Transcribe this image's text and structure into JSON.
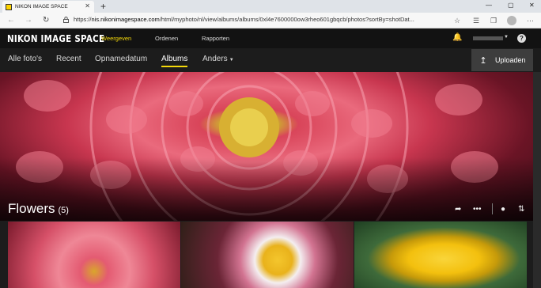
{
  "browser": {
    "tab_title": "NIKON IMAGE SPACE",
    "tab_close": "✕",
    "new_tab": "+",
    "window_controls": [
      "—",
      "▢",
      "✕"
    ],
    "url_scheme": "https://",
    "url_host": "nis.nikonimagespace.com",
    "url_rest": "/html/myphoto/nl/view/albums/albums/0xl4e7600000ow3rheo601gbqcb/photos?sortBy=shotDat...",
    "icons": [
      "back-icon",
      "forward-icon",
      "reload-icon",
      "lock-icon",
      "favorite-star-icon",
      "favorites-bar-icon",
      "collections-icon",
      "profile-icon",
      "more-icon"
    ]
  },
  "app": {
    "logo": "NIKON IMAGE SPACE",
    "top_nav": [
      "Weergeven",
      "Ordenen",
      "Rapporten"
    ],
    "active_top_nav": "Weergeven",
    "accent": "#f5d90a",
    "help": "?",
    "sub_nav": [
      "Alle foto's",
      "Recent",
      "Opnamedatum",
      "Albums",
      "Anders"
    ],
    "active_sub_nav": "Albums",
    "upload_label": "Uploaden"
  },
  "album": {
    "title": "Flowers",
    "count": "(5)",
    "actions": [
      "share-icon",
      "more-icon",
      "location-icon",
      "sort-icon"
    ]
  }
}
